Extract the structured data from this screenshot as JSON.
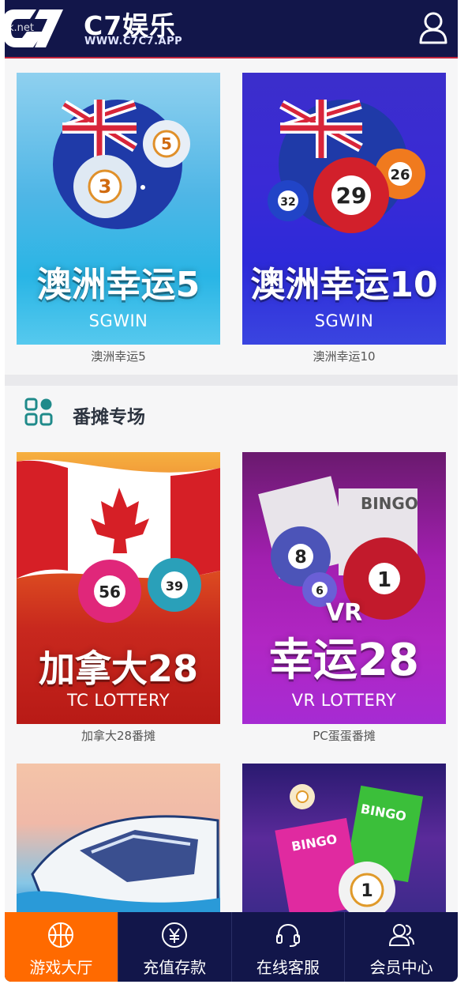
{
  "header": {
    "brand": "C7娱乐",
    "url": "WWW.C7C7.APP",
    "watermark": "k.net"
  },
  "games_top": [
    {
      "title_art": "澳洲幸运5",
      "provider": "SGWIN",
      "caption": "澳洲幸运5"
    },
    {
      "title_art": "澳洲幸运10",
      "provider": "SGWIN",
      "caption": "澳洲幸运10"
    }
  ],
  "section": {
    "title": "番摊专场",
    "icon": "grid-apps-icon"
  },
  "games_fantan": [
    {
      "title_art": "加拿大28",
      "provider": "TC LOTTERY",
      "caption": "加拿大28番摊",
      "ball1": "56",
      "ball2": "39"
    },
    {
      "title_art": "幸运28",
      "badge": "VR",
      "provider": "VR LOTTERY",
      "caption": "PC蛋蛋番摊",
      "bingo": "BINGO",
      "ball1": "8",
      "ball2": "1",
      "ball3": "6"
    }
  ],
  "games_bottom": [
    {
      "name": "boat-race-thumbnail"
    },
    {
      "name": "bingo-thumbnail",
      "bingo1": "BINGO",
      "bingo2": "BINGO",
      "ball": "1"
    }
  ],
  "ball_labels": {
    "au5_a": "5",
    "au5_b": "3",
    "au10_a": "29",
    "au10_b": "26",
    "au10_c": "32"
  },
  "tabbar": [
    {
      "label": "游戏大厅",
      "icon": "basketball-icon",
      "active": true
    },
    {
      "label": "充值存款",
      "icon": "yen-coin-icon",
      "active": false
    },
    {
      "label": "在线客服",
      "icon": "headset-icon",
      "active": false
    },
    {
      "label": "会员中心",
      "icon": "members-icon",
      "active": false
    }
  ],
  "colors": {
    "header_bg": "#12164a",
    "accent": "#ff6a00",
    "header_line": "#c0243c"
  }
}
